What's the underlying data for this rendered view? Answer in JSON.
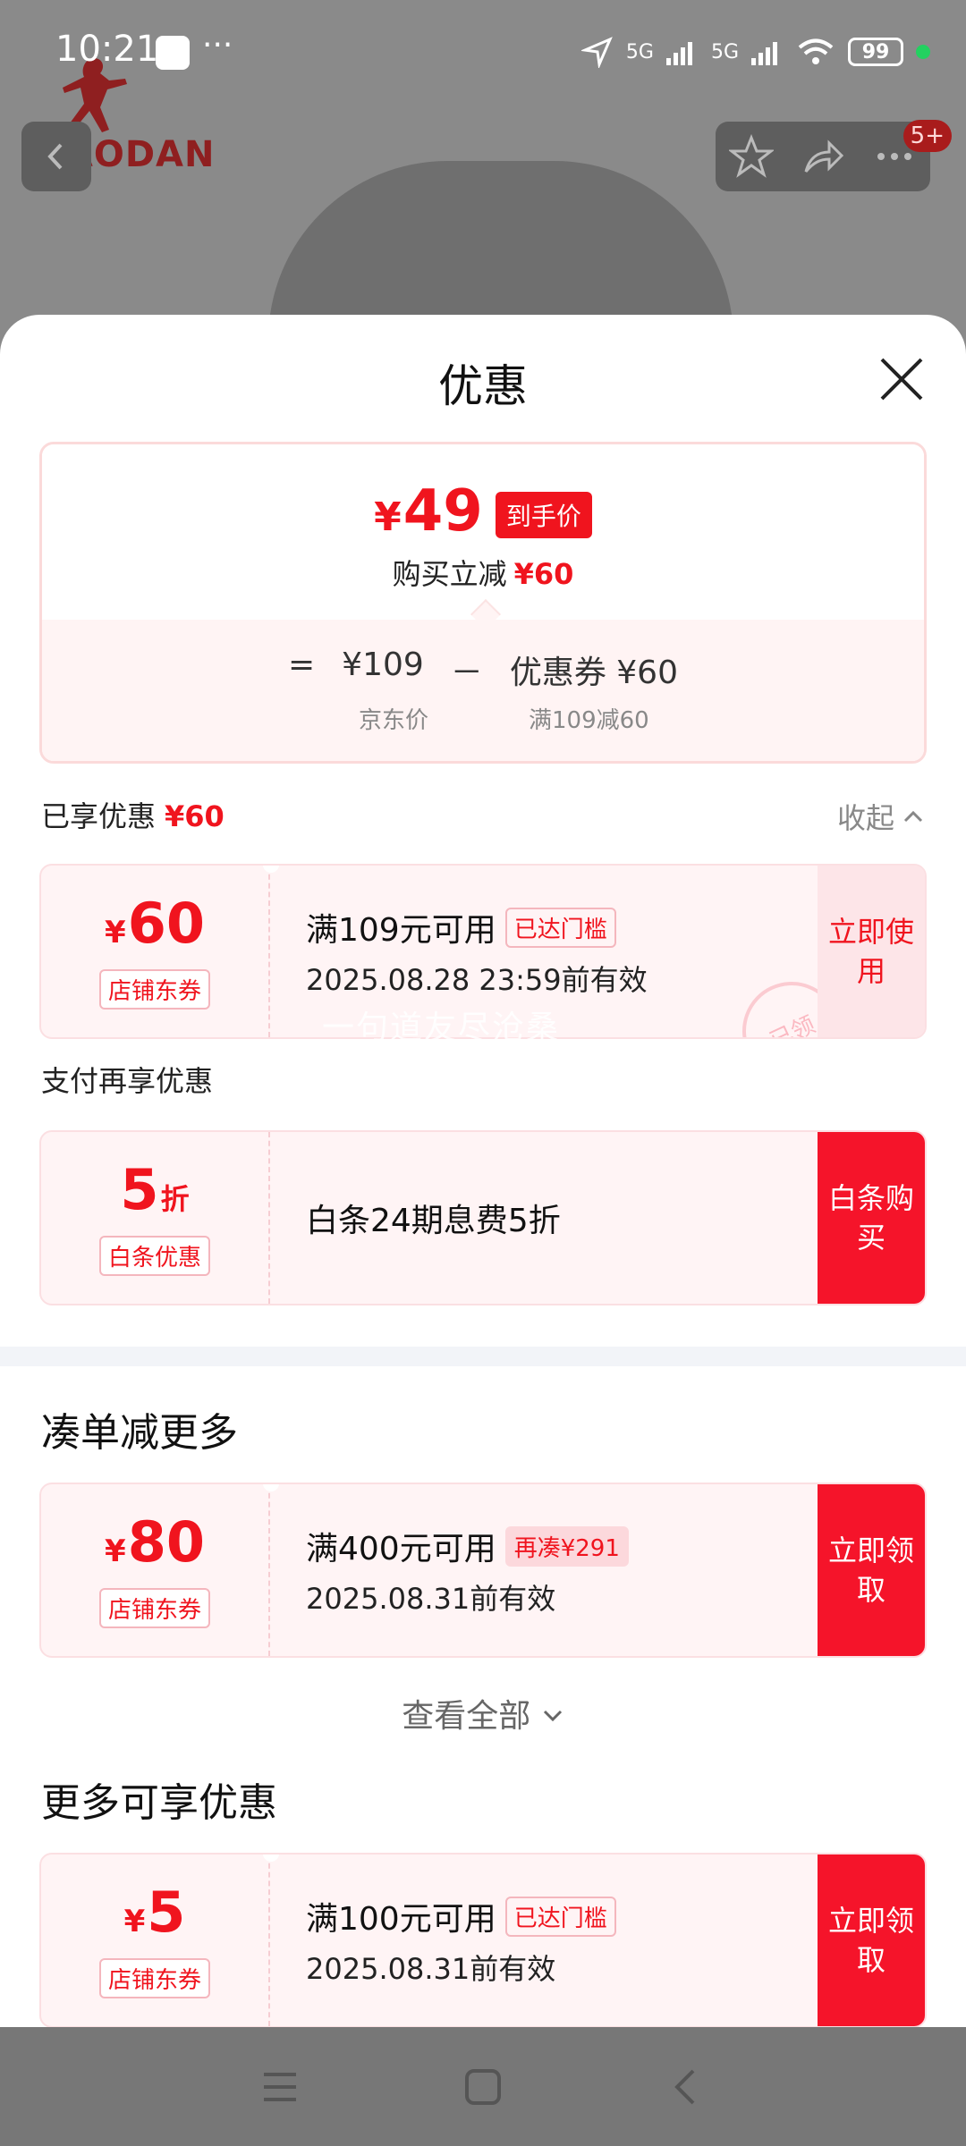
{
  "status_bar": {
    "time": "10:21",
    "dots": "···",
    "signal1": "5G",
    "signal2": "5G",
    "battery": "99"
  },
  "background": {
    "brand_logo": "QIAODAN",
    "notification_badge": "5+"
  },
  "sheet": {
    "title": "优惠",
    "summary": {
      "final_price_symbol": "¥",
      "final_price": "49",
      "price_tag": "到手价",
      "reduce_label": "购买立减",
      "reduce_value": "¥60",
      "formula_eq": "=",
      "jd_price": "¥109",
      "formula_minus": "－",
      "coupon_label": "优惠券 ¥60",
      "jd_price_label": "京东价",
      "coupon_rule": "满109减60"
    },
    "enjoyed": {
      "label": "已享优惠",
      "value": "¥60",
      "collapse": "收起"
    },
    "coupon_enjoyed": {
      "symbol": "¥",
      "amount": "60",
      "type": "店铺东券",
      "condition": "满109元可用",
      "tag": "已达门槛",
      "date": "2025.08.28 23:59前有效",
      "button": "立即使用",
      "stamp": "已领"
    },
    "pay_more": {
      "label": "支付再享优惠"
    },
    "coupon_baitiao": {
      "amount": "5",
      "unit": "折",
      "type": "白条优惠",
      "text": "白条24期息费5折",
      "button": "白条购买"
    },
    "watermark": "一句道友尽沧桑",
    "section_combine": {
      "title": "凑单减更多"
    },
    "coupon_combine": {
      "symbol": "¥",
      "amount": "80",
      "type": "店铺东券",
      "condition": "满400元可用",
      "tag": "再凑¥291",
      "date": "2025.08.31前有效",
      "button": "立即领取"
    },
    "view_all": "查看全部",
    "section_more": {
      "title": "更多可享优惠"
    },
    "coupon_more": {
      "symbol": "¥",
      "amount": "5",
      "type": "店铺东券",
      "condition": "满100元可用",
      "tag": "已达门槛",
      "date": "2025.08.31前有效",
      "button": "立即领取"
    }
  },
  "colors": {
    "accent": "#f0141e",
    "coupon_bg": "#fff4f5",
    "button_red": "#f5142a"
  }
}
